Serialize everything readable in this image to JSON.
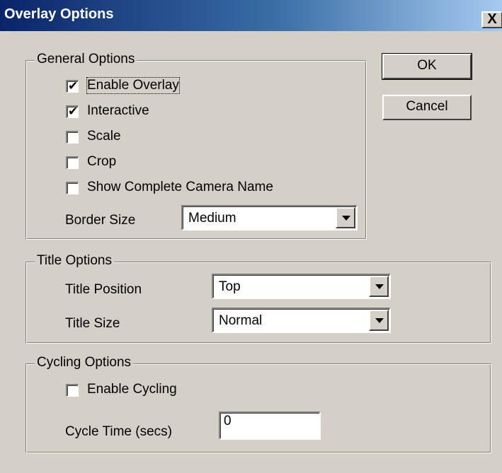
{
  "window": {
    "title": "Overlay Options",
    "close_label": "X"
  },
  "buttons": {
    "ok": "OK",
    "cancel": "Cancel"
  },
  "general": {
    "legend": "General Options",
    "checkboxes": [
      {
        "label": "Enable Overlay",
        "checked": true
      },
      {
        "label": "Interactive",
        "checked": true
      },
      {
        "label": "Scale",
        "checked": false
      },
      {
        "label": "Crop",
        "checked": false
      },
      {
        "label": "Show Complete Camera Name",
        "checked": false
      }
    ],
    "border_size_label": "Border Size",
    "border_size_value": "Medium"
  },
  "title_options": {
    "legend": "Title Options",
    "position_label": "Title Position",
    "position_value": "Top",
    "size_label": "Title Size",
    "size_value": "Normal"
  },
  "cycling": {
    "legend": "Cycling Options",
    "enable_label": "Enable Cycling",
    "enable_checked": false,
    "cycle_time_label": "Cycle Time (secs)",
    "cycle_time_value": "0"
  },
  "glyphs": {
    "checkmark": "✔"
  }
}
